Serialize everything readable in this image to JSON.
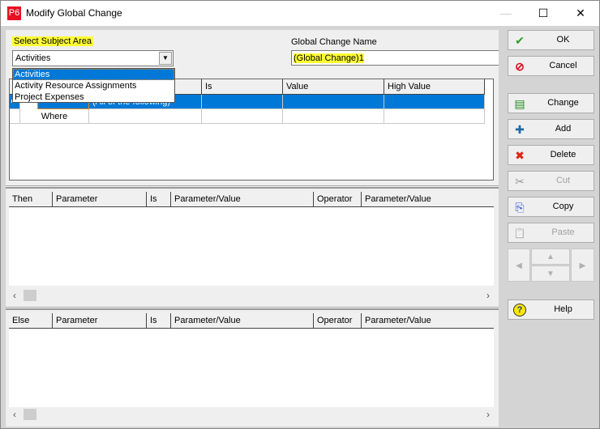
{
  "window": {
    "app_icon_label": "P6",
    "title": "Modify Global Change",
    "minimize_label": "—",
    "maximize_label": "☐",
    "close_label": "✕"
  },
  "subject_area": {
    "label": "Select Subject Area",
    "selected": "Activities",
    "dropdown_arrow": "▼",
    "options": [
      "Activities",
      "Activity Resource Assignments",
      "Project Expenses"
    ]
  },
  "global_change_name": {
    "label": "Global Change Name",
    "value": "(Global Change)1"
  },
  "where_grid": {
    "columns": [
      "",
      "Is",
      "Value",
      "High Value"
    ],
    "rows": [
      {
        "col1": "",
        "col2": "(All of the following)",
        "is": "",
        "value": "",
        "high_value": ""
      },
      {
        "col1": "Where",
        "col2": "",
        "is": "",
        "value": "",
        "high_value": ""
      }
    ]
  },
  "then_grid": {
    "columns": [
      "Then",
      "Parameter",
      "Is",
      "Parameter/Value",
      "Operator",
      "Parameter/Value"
    ]
  },
  "else_grid": {
    "columns": [
      "Else",
      "Parameter",
      "Is",
      "Parameter/Value",
      "Operator",
      "Parameter/Value"
    ]
  },
  "scroll": {
    "left_arrow": "‹",
    "right_arrow": "›"
  },
  "buttons": {
    "ok": {
      "label": "OK",
      "icon": "✔",
      "color": "#2e9e2e"
    },
    "cancel": {
      "label": "Cancel",
      "icon": "⊘",
      "color": "#d8141e"
    },
    "change": {
      "label": "Change",
      "icon": "▤"
    },
    "add": {
      "label": "Add",
      "icon": "✚"
    },
    "delete": {
      "label": "Delete",
      "icon": "✖",
      "color": "#e02010"
    },
    "cut": {
      "label": "Cut",
      "icon": "✂",
      "disabled": true
    },
    "copy": {
      "label": "Copy",
      "icon": "⎘"
    },
    "paste": {
      "label": "Paste",
      "icon": "📋",
      "disabled": true
    },
    "help": {
      "label": "Help",
      "icon": "?"
    }
  },
  "nav": {
    "left": "◀",
    "up": "▲",
    "down": "▼",
    "right": "▶"
  }
}
